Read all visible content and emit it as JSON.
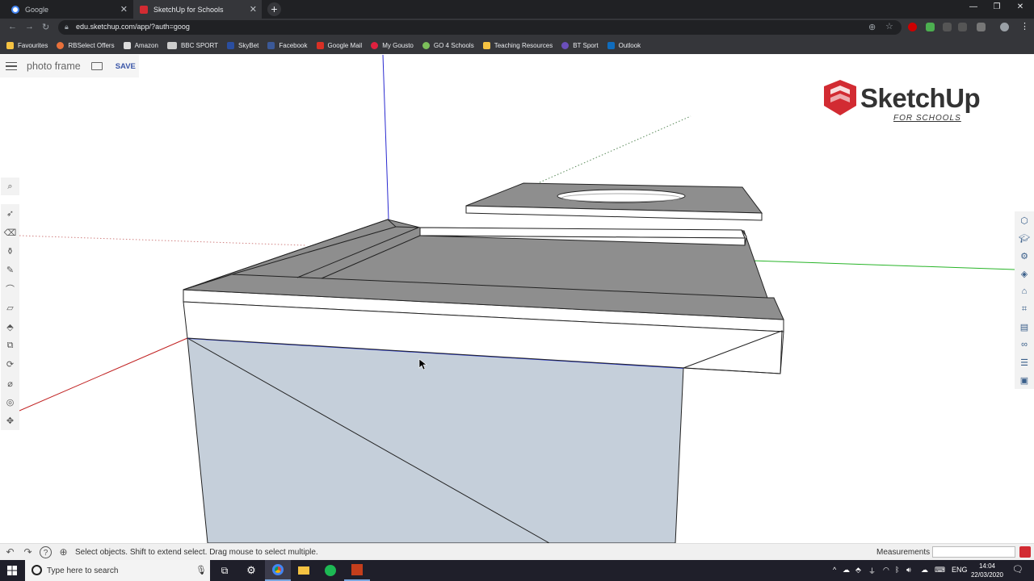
{
  "browser": {
    "tabs": [
      {
        "label": "Google",
        "active": false
      },
      {
        "label": "SketchUp for Schools",
        "active": true
      }
    ],
    "new_tab_symbol": "+",
    "url": "edu.sketchup.com/app/?auth=goog",
    "window_controls": [
      "—",
      "❐",
      "✕"
    ]
  },
  "bookmarks": [
    {
      "label": "Favourites",
      "icon": "folder-icon",
      "color": "#f6c342"
    },
    {
      "label": "RBSelect Offers",
      "icon": "rbselect-icon",
      "color": "#e8703a"
    },
    {
      "label": "Amazon",
      "icon": "amazon-icon",
      "color": "#dddddd"
    },
    {
      "label": "BBC SPORT",
      "icon": "bbc-icon",
      "color": "#cccccc"
    },
    {
      "label": "SkyBet",
      "icon": "skybet-icon",
      "color": "#2a4ea0"
    },
    {
      "label": "Facebook",
      "icon": "facebook-icon",
      "color": "#3b5998"
    },
    {
      "label": "Google Mail",
      "icon": "gmail-icon",
      "color": "#d93025"
    },
    {
      "label": "My Gousto",
      "icon": "gousto-icon",
      "color": "#e0213f"
    },
    {
      "label": "GO 4 Schools",
      "icon": "go4schools-icon",
      "color": "#7cbf5a"
    },
    {
      "label": "Teaching Resources",
      "icon": "folder-icon",
      "color": "#f6c342"
    },
    {
      "label": "BT Sport",
      "icon": "btsport-icon",
      "color": "#6b4fbb"
    },
    {
      "label": "Outlook",
      "icon": "outlook-icon",
      "color": "#0f6cbd"
    }
  ],
  "app": {
    "model_name": "photo frame",
    "save_label": "SAVE",
    "logo_text": "SketchUp",
    "logo_subtext": "FOR SCHOOLS",
    "brand_color": "#d22b32"
  },
  "left_toolbar": [
    "search-icon",
    "select-icon",
    "eraser-icon",
    "paint-bucket-icon",
    "line-icon",
    "arc-icon",
    "rectangle-icon",
    "push-pull-icon",
    "move-icon",
    "rotate-icon",
    "tape-measure-icon",
    "orbit-icon",
    "pan-icon"
  ],
  "right_toolbar": [
    "entity-info-icon",
    "instructor-icon",
    "components-icon",
    "materials-icon",
    "styles-icon",
    "tags-icon",
    "scenes-icon",
    "display-icon",
    "outliner-icon",
    "solid-inspector-icon"
  ],
  "status": {
    "hint": "Select objects. Shift to extend select. Drag mouse to select multiple.",
    "measurements_label": "Measurements",
    "measurements_value": ""
  },
  "taskbar": {
    "search_placeholder": "Type here to search",
    "language": "ENG",
    "time": "14:04",
    "date": "22/03/2020"
  }
}
